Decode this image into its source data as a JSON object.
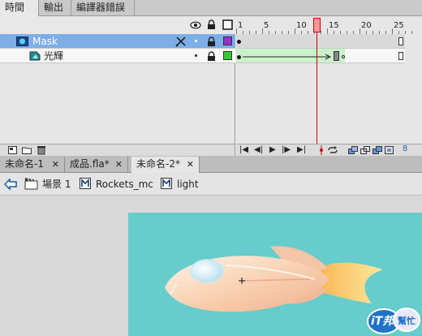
{
  "panel_tabs": [
    {
      "label": "時間軸",
      "active": true
    },
    {
      "label": "輸出",
      "active": false
    },
    {
      "label": "編譯器錯誤",
      "active": false
    }
  ],
  "timeline": {
    "frame_numbers": [
      "1",
      "5",
      "10",
      "15",
      "20",
      "25"
    ],
    "playhead_frame": 13,
    "layers": [
      {
        "name": "Mask",
        "selected": true,
        "color": "#9933cc",
        "type": "mask"
      },
      {
        "name": "光輝",
        "selected": false,
        "color": "#33cc33",
        "type": "masked"
      }
    ],
    "colors": {
      "selected_row": "#7eaee8",
      "tween_fill": "#ccf2cc",
      "playhead": "#cc0000",
      "playhead_fill": "#ff9999"
    }
  },
  "doc_tabs": [
    {
      "label": "未命名-1",
      "active": false
    },
    {
      "label": "成品.fla*",
      "active": false
    },
    {
      "label": "未命名-2*",
      "active": true
    }
  ],
  "breadcrumb": {
    "items": [
      {
        "label": "場景 1",
        "icon": "scene-icon"
      },
      {
        "label": "Rockets_mc",
        "icon": "movieclip-icon"
      },
      {
        "label": "light",
        "icon": "movieclip-icon"
      }
    ]
  },
  "stage": {
    "background": "#66cccc"
  },
  "watermark": {
    "text": "iT邦",
    "subtext": "幫忙"
  }
}
